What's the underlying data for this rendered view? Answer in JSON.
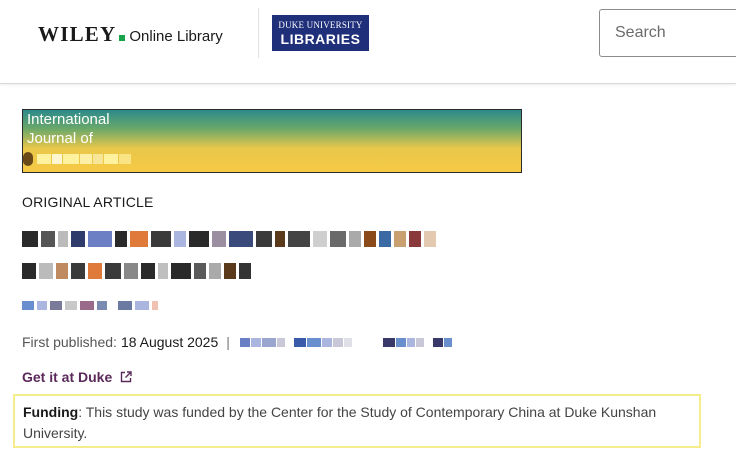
{
  "header": {
    "wiley_word": "WILEY",
    "wiley_sub": "Online Library",
    "duke_top": "DUKE UNIVERSITY",
    "duke_bottom": "LIBRARIES",
    "search_placeholder": "Search"
  },
  "journal": {
    "line1": "International",
    "line2": "Journal of"
  },
  "article": {
    "type": "ORIGINAL ARTICLE",
    "first_published_label": "First published:",
    "first_published_date": "18 August 2025",
    "separator": "|"
  },
  "access": {
    "get_it_label": "Get it at Duke"
  },
  "funding": {
    "label": "Funding",
    "text": ": This study was funded by the Center for the Study of Contemporary China at Duke Kunshan University."
  },
  "colors": {
    "wiley_green": "#16a34a",
    "duke_navy": "#1f2f7a",
    "get_it_link": "#5a2a5a",
    "funding_border": "#f5ec8c"
  }
}
